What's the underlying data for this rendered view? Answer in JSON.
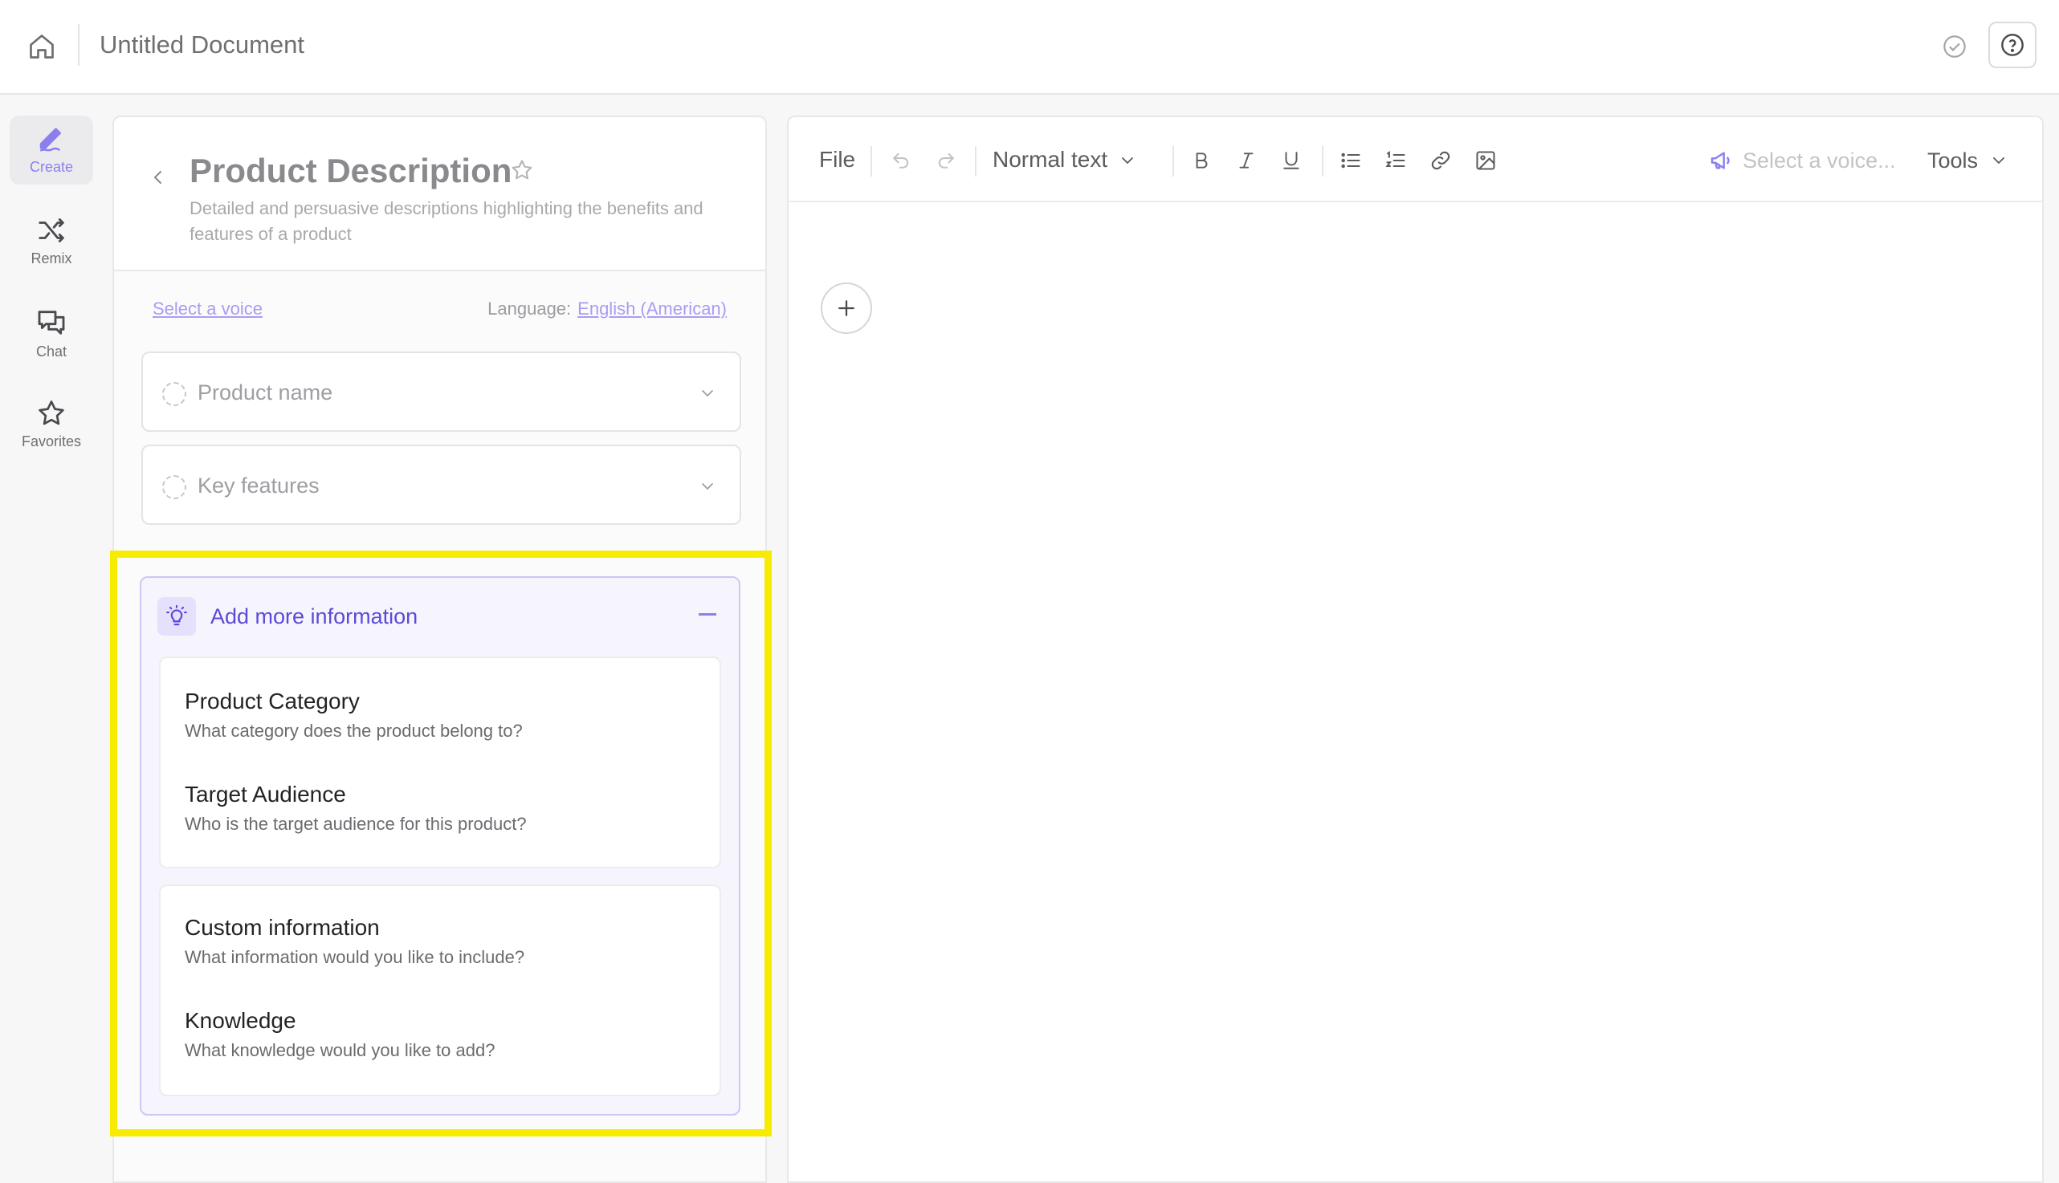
{
  "topbar": {
    "doc_title": "Untitled Document",
    "icons": [
      "home-icon",
      "check-circle-icon",
      "help-icon"
    ]
  },
  "rail": {
    "items": [
      {
        "label": "Create",
        "icon": "pen-icon",
        "active": true
      },
      {
        "label": "Remix",
        "icon": "shuffle-icon",
        "active": false
      },
      {
        "label": "Chat",
        "icon": "chat-bubbles-icon",
        "active": false
      },
      {
        "label": "Favorites",
        "icon": "star-icon",
        "active": false
      }
    ]
  },
  "panel": {
    "title": "Product Description",
    "description": "Detailed and persuasive descriptions highlighting the benefits and features of a product",
    "select_voice": "Select a voice",
    "language_label": "Language:",
    "language_value": "English (American)",
    "fields": [
      {
        "label": "Product name"
      },
      {
        "label": "Key features"
      }
    ],
    "more_info": {
      "title": "Add more information",
      "groups": [
        [
          {
            "title": "Product Category",
            "subtitle": "What category does the product belong to?"
          },
          {
            "title": "Target Audience",
            "subtitle": "Who is the target audience for this product?"
          }
        ],
        [
          {
            "title": "Custom information",
            "subtitle": "What information would you like to include?"
          },
          {
            "title": "Knowledge",
            "subtitle": "What knowledge would you like to add?"
          }
        ]
      ]
    }
  },
  "editor": {
    "toolbar": {
      "file": "File",
      "text_style": "Normal text",
      "voice_placeholder": "Select a voice...",
      "tools": "Tools"
    }
  },
  "colors": {
    "accent": "#8b7ff0",
    "accent_dark": "#5b4ad9",
    "highlight": "#f7ec00"
  }
}
